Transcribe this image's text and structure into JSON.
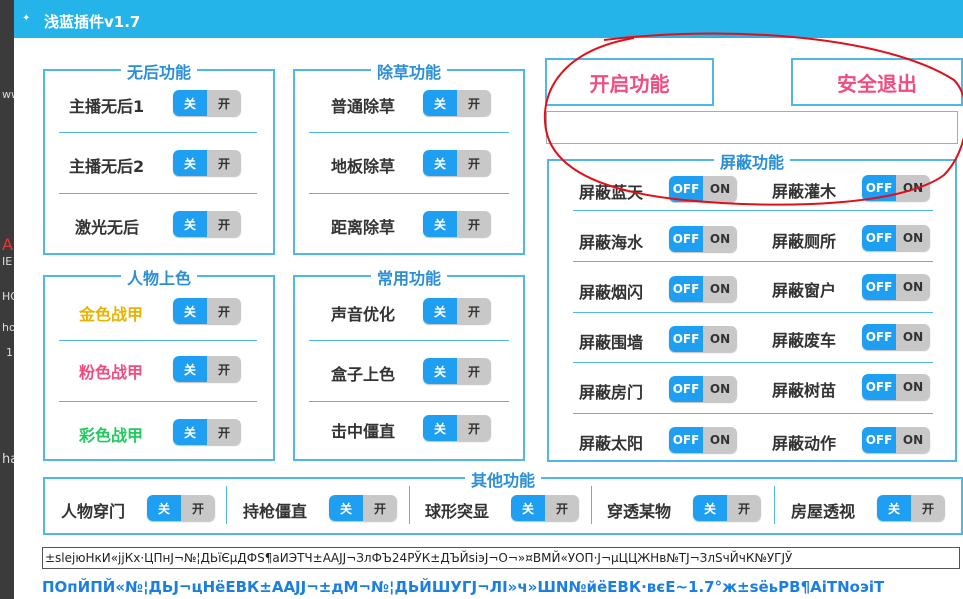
{
  "app": {
    "title": "浅蓝插件v1.7"
  },
  "colors": {
    "accent": "#25b4ea",
    "border": "#4fb6ea",
    "legend": "#2a8fd6",
    "action": "#ef4e7e",
    "gold": "#e8b400",
    "pink": "#ef4e7e",
    "green": "#1fca5e",
    "toggle_on": "#1e9ff2",
    "toggle_off": "#c8c8c8",
    "annotation": "#e0101a"
  },
  "background": {
    "left_texts": [
      "ww",
      "A",
      "IE",
      "HO",
      "ho",
      "1",
      "ha"
    ]
  },
  "toggle_cn": {
    "on": "关",
    "off": "开"
  },
  "toggle_en": {
    "on": "OFF",
    "off": "ON"
  },
  "panels": {
    "wuhou": {
      "title": "无后功能",
      "items": [
        "主播无后1",
        "主播无后2",
        "激光无后"
      ]
    },
    "chucao": {
      "title": "除草功能",
      "items": [
        "普通除草",
        "地板除草",
        "距离除草"
      ]
    },
    "renwu": {
      "title": "人物上色",
      "items": [
        "金色战甲",
        "粉色战甲",
        "彩色战甲"
      ]
    },
    "changyong": {
      "title": "常用功能",
      "items": [
        "声音优化",
        "盒子上色",
        "击中僵直"
      ]
    },
    "pingbi": {
      "title": "屏蔽功能",
      "left": [
        "屏蔽蓝天",
        "屏蔽海水",
        "屏蔽烟闪",
        "屏蔽围墙",
        "屏蔽房门",
        "屏蔽太阳"
      ],
      "right": [
        "屏蔽灌木",
        "屏蔽厕所",
        "屏蔽窗户",
        "屏蔽废车",
        "屏蔽树苗",
        "屏蔽动作"
      ]
    },
    "qita": {
      "title": "其他功能",
      "items": [
        "人物穿门",
        "持枪僵直",
        "球形突显",
        "穿透某物",
        "房屋透视"
      ]
    }
  },
  "actions": {
    "start": "开启功能",
    "exit": "安全退出"
  },
  "input": {
    "value": ""
  },
  "bottom": {
    "garbled1": "±slejюНкИ«jjКх·ЦПнЈ¬№¦ДЬїЄµДФЅ¶аИЭТЧ±ААЈЈ¬ЗлФЪ24РЎК±ДЪЙsiэЈ¬О¬»¤ВМЙ«УОП·Ј¬µЦЦЖНв№ТЈ¬ЗлЅчЙчК№УГЈЎ",
    "garbled2": "ПОпЙПЙ«№¦ДЬЈ¬цНёЕВК±ААЈЈ¬±дМ¬№¦ДЬЙШУГЈ¬ЛI»ч»ШN№йёЕВК·вєЕ~1.7°ж±sёьРВ¶АiТNoэiТ"
  }
}
